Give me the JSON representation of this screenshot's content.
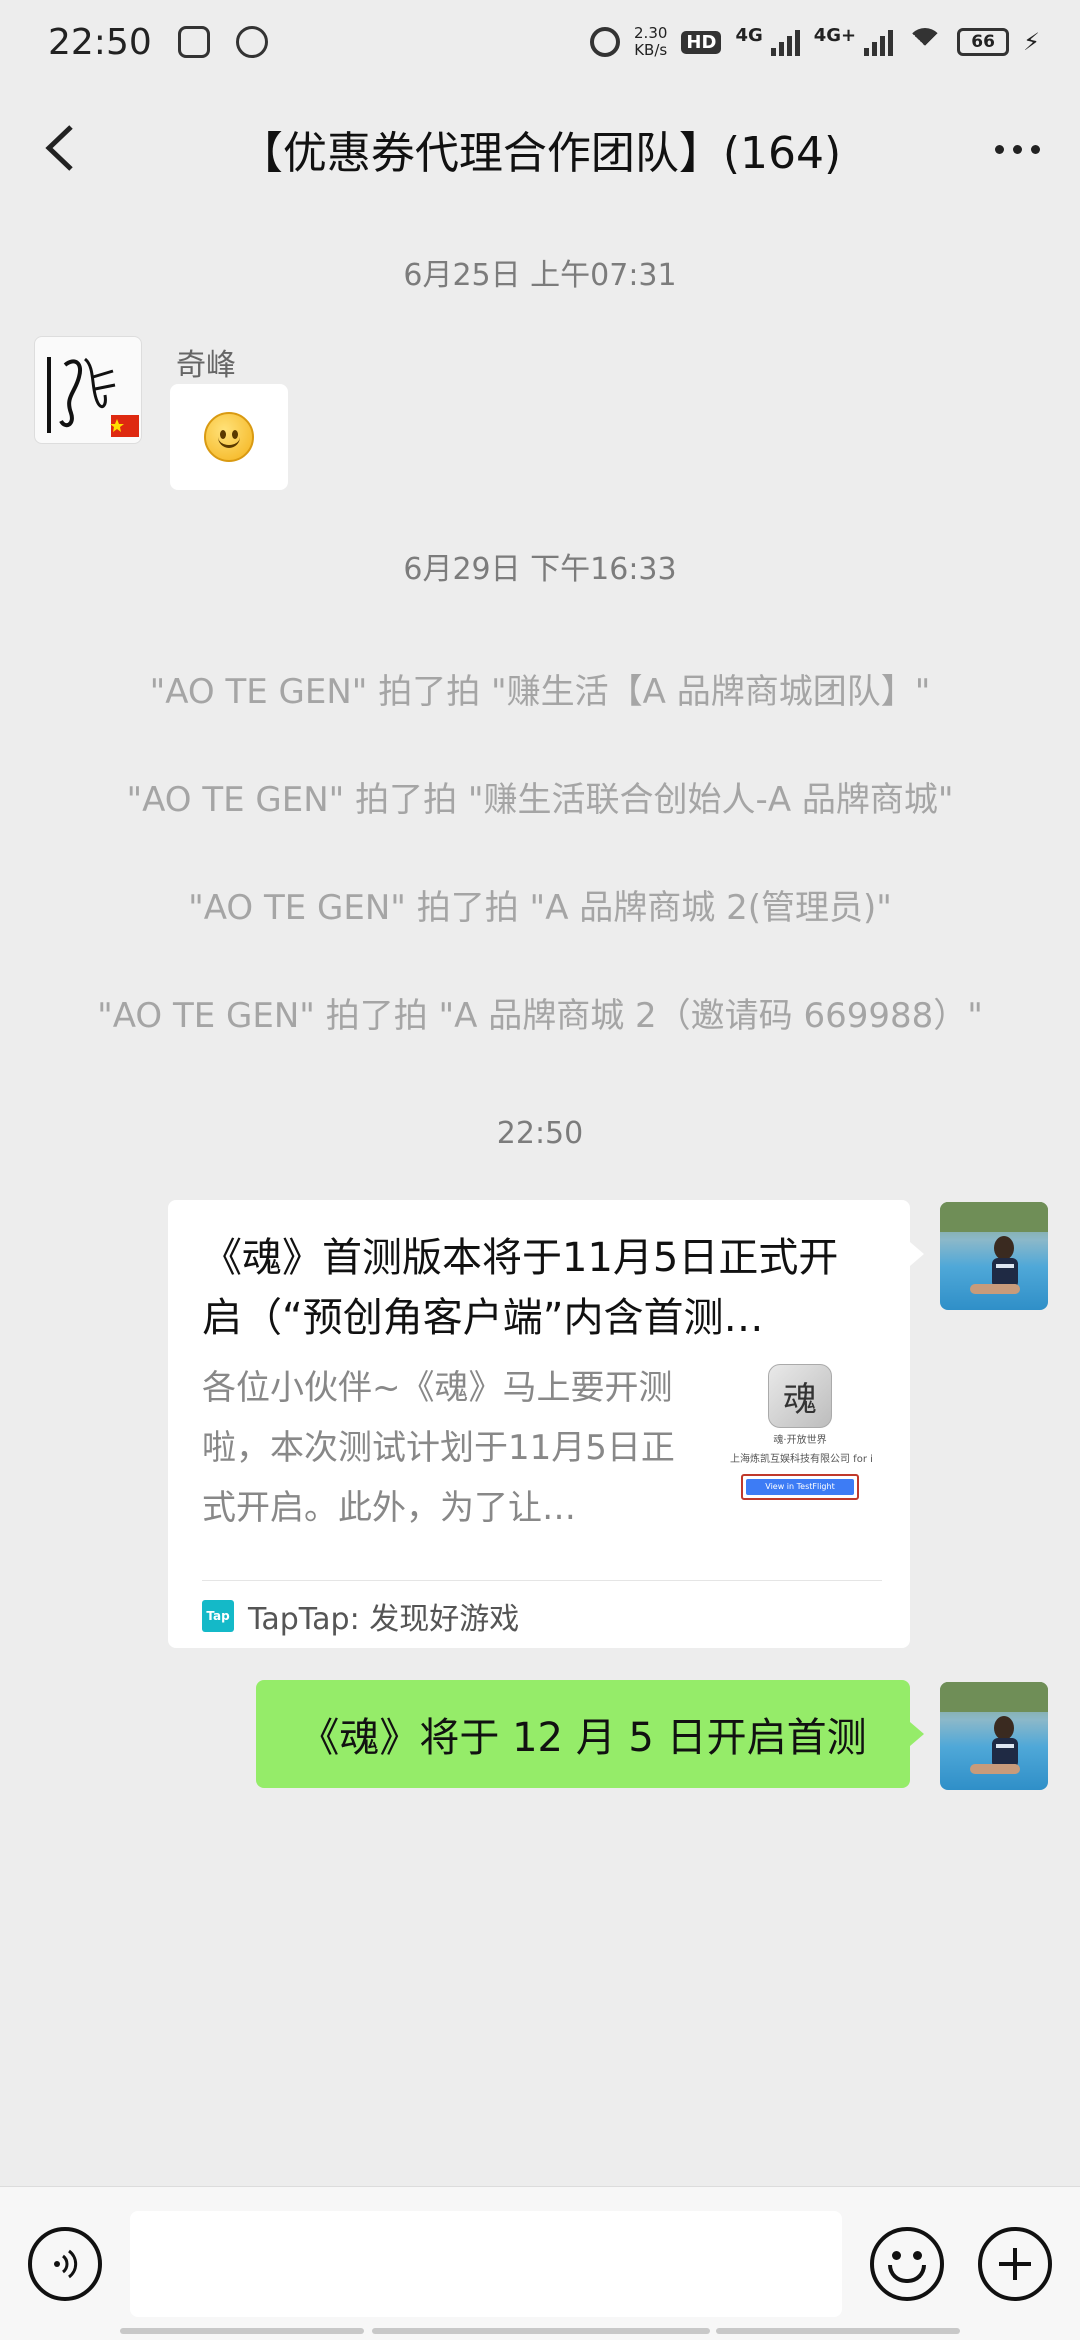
{
  "status_bar": {
    "time": "22:50",
    "net_speed_value": "2.30",
    "net_speed_unit": "KB/s",
    "hd_label": "HD",
    "sim1_label": "4G",
    "sim2_label": "4G+",
    "battery_level": "66"
  },
  "header": {
    "title": "【优惠券代理合作团队】(164)"
  },
  "messages": {
    "ts1": "6月25日 上午07:31",
    "sender1_name": "奇峰",
    "ts2": "6月29日 下午16:33",
    "sys": [
      "\"AO TE GEN\" 拍了拍 \"赚生活【A 品牌商城团队】\"",
      "\"AO TE GEN\" 拍了拍 \"赚生活联合创始人-A 品牌商城\"",
      "\"AO TE GEN\" 拍了拍 \"A 品牌商城 2(管理员)\"",
      "\"AO TE GEN\" 拍了拍 \"A 品牌商城 2（邀请码 669988）\""
    ],
    "ts3": "22:50",
    "card": {
      "title": "《魂》首测版本将于11月5日正式开启（“预创角客户端”内含首测…",
      "desc": "各位小伙伴~《魂》马上要开测啦，本次测试计划于11月5日正式开启。此外，为了让…",
      "thumb_app_char": "魂",
      "thumb_line1": "魂·开放世界",
      "thumb_line2": "上海炼凯互娱科技有限公司 for i",
      "thumb_button": "View in TestFlight",
      "source_icon": "Tap",
      "source": "TapTap: 发现好游戏"
    },
    "text_msg": "《魂》将于 12 月 5 日开启首测"
  },
  "input_bar": {
    "placeholder": ""
  },
  "colors": {
    "background": "#ededed",
    "bubble_green": "#95ec69",
    "system_text": "#a5a5a5",
    "taptap": "#14b9c8"
  }
}
